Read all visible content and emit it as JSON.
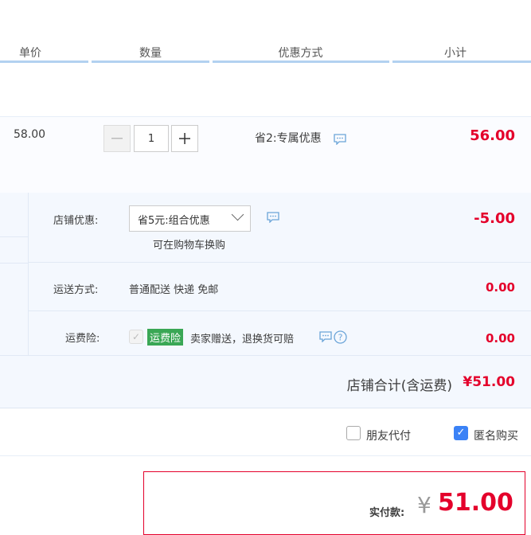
{
  "header": {
    "col_unit_price": "单价",
    "col_quantity": "数量",
    "col_discount": "优惠方式",
    "col_subtotal": "小计"
  },
  "item": {
    "unit_price": "58.00",
    "quantity": "1",
    "discount": "省2:专属优惠",
    "subtotal": "56.00"
  },
  "shop": {
    "discount_label": "店铺优惠:",
    "discount_selected": "省5元:组合优惠",
    "discount_hint": "可在购物车换购",
    "discount_amount": "-5.00",
    "shipping_label": "运送方式:",
    "shipping_value": "普通配送 快递 免邮",
    "shipping_amount": "0.00",
    "insurance_label": "运费险:",
    "insurance_badge": "运费险",
    "insurance_text": "卖家赠送，退换货可赔",
    "insurance_amount": "0.00",
    "total_label": "店铺合计(含运费)",
    "total_amount": "¥51.00"
  },
  "options": {
    "friend_pay": "朋友代付",
    "anonymous": "匿名购买"
  },
  "payment": {
    "label": "实付款:",
    "currency": "¥",
    "amount": "51.00"
  },
  "colors": {
    "accent_red": "#e4002b",
    "header_line": "#b2d1f0",
    "badge_green": "#3aa755",
    "checkbox_blue": "#3b82f6"
  }
}
